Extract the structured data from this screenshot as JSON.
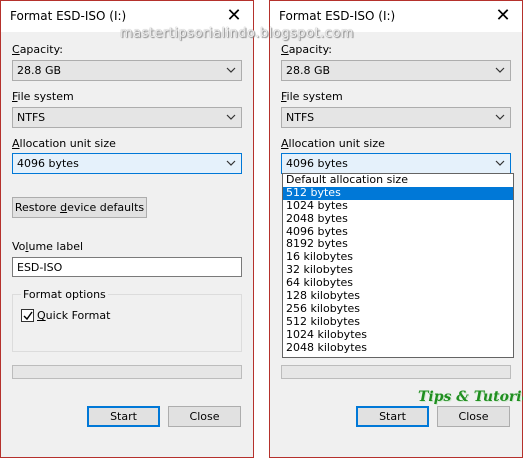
{
  "watermark": "mastertipsorialindo.blogspot.com",
  "logo": "Tips & Tutorial",
  "left": {
    "title": "Format ESD-ISO (I:)",
    "capacity_label": "Capacity:",
    "capacity_value": "28.8 GB",
    "filesystem_label": "File system",
    "filesystem_value": "NTFS",
    "allocation_label": "Allocation unit size",
    "allocation_value": "4096 bytes",
    "restore_button": "Restore device defaults",
    "volume_label": "Volume label",
    "volume_value": "ESD-ISO",
    "format_options_label": "Format options",
    "quick_format_label": "Quick Format",
    "quick_format_checked": true,
    "progress": 0,
    "start_button": "Start",
    "close_button": "Close"
  },
  "right": {
    "title": "Format ESD-ISO (I:)",
    "capacity_label": "Capacity:",
    "capacity_value": "28.8 GB",
    "filesystem_label": "File system",
    "filesystem_value": "NTFS",
    "allocation_label": "Allocation unit size",
    "allocation_value": "4096 bytes",
    "allocation_options": [
      "Default allocation size",
      "512 bytes",
      "1024 bytes",
      "2048 bytes",
      "4096 bytes",
      "8192 bytes",
      "16 kilobytes",
      "32 kilobytes",
      "64 kilobytes",
      "128 kilobytes",
      "256 kilobytes",
      "512 kilobytes",
      "1024 kilobytes",
      "2048 kilobytes"
    ],
    "highlighted_option_index": 1,
    "progress": 0,
    "start_button": "Start",
    "close_button": "Close"
  },
  "colors": {
    "accent": "#0078d7",
    "dialog_bg": "#f0f0f0",
    "separator": "#b5312c",
    "logo": "#1f8f1f"
  }
}
